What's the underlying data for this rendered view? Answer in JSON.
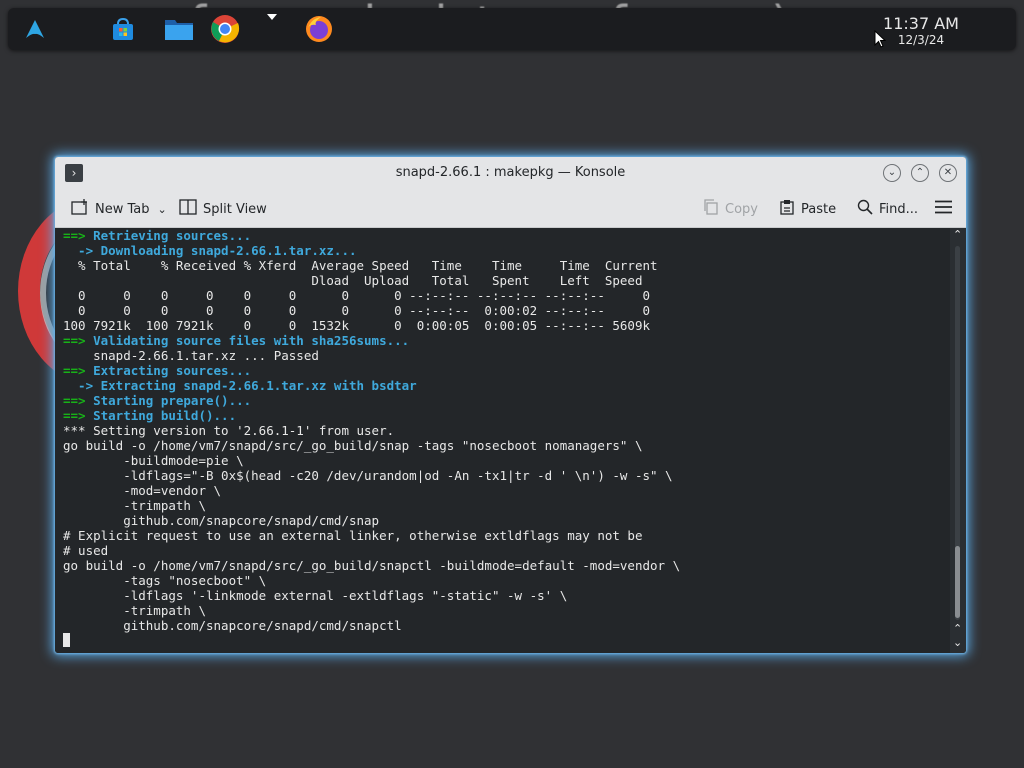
{
  "wallpaper": {
    "text": "fan noob vietnam funny :)"
  },
  "panel": {
    "apps": [
      {
        "icon": "arch-launcher-icon"
      },
      {
        "icon": "store-icon"
      },
      {
        "icon": "folder-icon"
      },
      {
        "icon": "chrome-icon"
      },
      {
        "icon": "firefox-icon"
      }
    ],
    "clock": {
      "time": "11:37 AM",
      "date": "12/3/24"
    }
  },
  "window": {
    "title": "snapd-2.66.1 : makepkg — Konsole",
    "buttons": [
      "minimize",
      "maximize",
      "close"
    ],
    "toolbar": {
      "new_tab": "New Tab",
      "split_view": "Split View",
      "copy": "Copy",
      "paste": "Paste",
      "find": "Find..."
    }
  },
  "terminal": {
    "colors": {
      "background": "#232629",
      "text": "#e8e8e8",
      "arrow": "#18b218",
      "info": "#3fa9dc"
    },
    "lines": [
      {
        "type": "main",
        "arrow": "==>",
        "text": " Retrieving sources..."
      },
      {
        "type": "sub",
        "text": "  -> Downloading snapd-2.66.1.tar.xz..."
      },
      {
        "type": "plain",
        "text": "  % Total    % Received % Xferd  Average Speed   Time    Time     Time  Current"
      },
      {
        "type": "plain",
        "text": "                                 Dload  Upload   Total   Spent    Left  Speed"
      },
      {
        "type": "plain",
        "text": "  0     0    0     0    0     0      0      0 --:--:-- --:--:-- --:--:--     0"
      },
      {
        "type": "plain",
        "text": "  0     0    0     0    0     0      0      0 --:--:--  0:00:02 --:--:--     0"
      },
      {
        "type": "plain",
        "text": "100 7921k  100 7921k    0     0  1532k      0  0:00:05  0:00:05 --:--:-- 5609k"
      },
      {
        "type": "main",
        "arrow": "==>",
        "text": " Validating source files with sha256sums..."
      },
      {
        "type": "plain",
        "text": "    snapd-2.66.1.tar.xz ... Passed"
      },
      {
        "type": "main",
        "arrow": "==>",
        "text": " Extracting sources..."
      },
      {
        "type": "sub",
        "text": "  -> Extracting snapd-2.66.1.tar.xz with bsdtar"
      },
      {
        "type": "main",
        "arrow": "==>",
        "text": " Starting prepare()..."
      },
      {
        "type": "main",
        "arrow": "==>",
        "text": " Starting build()..."
      },
      {
        "type": "plain",
        "text": "*** Setting version to '2.66.1-1' from user."
      },
      {
        "type": "plain",
        "text": "go build -o /home/vm7/snapd/src/_go_build/snap -tags \"nosecboot nomanagers\" \\"
      },
      {
        "type": "plain",
        "text": "        -buildmode=pie \\"
      },
      {
        "type": "plain",
        "text": "        -ldflags=\"-B 0x$(head -c20 /dev/urandom|od -An -tx1|tr -d ' \\n') -w -s\" \\"
      },
      {
        "type": "plain",
        "text": "        -mod=vendor \\"
      },
      {
        "type": "plain",
        "text": "        -trimpath \\"
      },
      {
        "type": "plain",
        "text": "        github.com/snapcore/snapd/cmd/snap"
      },
      {
        "type": "plain",
        "text": "# Explicit request to use an external linker, otherwise extldflags may not be"
      },
      {
        "type": "plain",
        "text": "# used"
      },
      {
        "type": "plain",
        "text": "go build -o /home/vm7/snapd/src/_go_build/snapctl -buildmode=default -mod=vendor \\"
      },
      {
        "type": "plain",
        "text": "        -tags \"nosecboot\" \\"
      },
      {
        "type": "plain",
        "text": "        -ldflags '-linkmode external -extldflags \"-static\" -w -s' \\"
      },
      {
        "type": "plain",
        "text": "        -trimpath \\"
      },
      {
        "type": "plain",
        "text": "        github.com/snapcore/snapd/cmd/snapctl"
      }
    ]
  }
}
